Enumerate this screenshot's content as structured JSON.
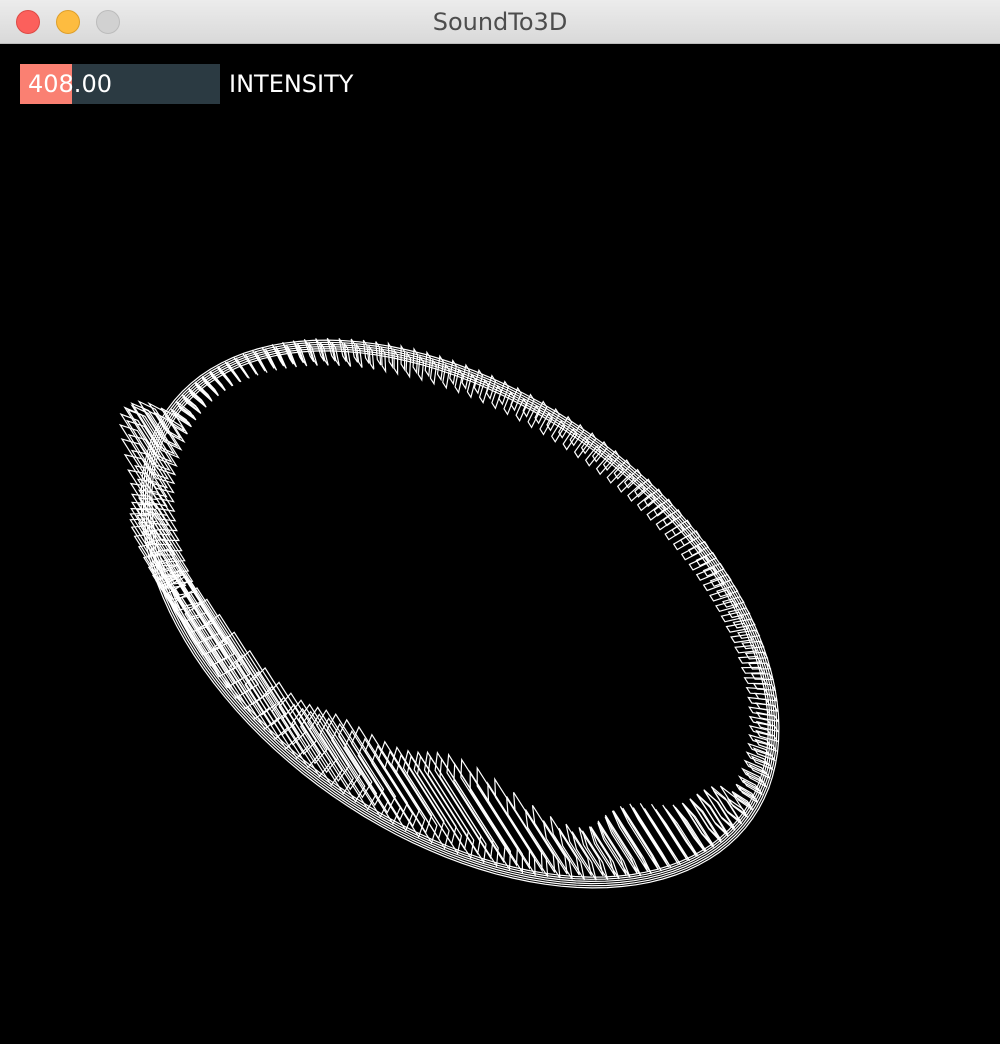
{
  "window": {
    "title": "SoundTo3D"
  },
  "controls": {
    "intensity": {
      "value_text": "408.00",
      "label": "INTENSITY",
      "fill_fraction": 0.26
    }
  },
  "colors": {
    "background": "#000000",
    "slider_track": "#2b3a42",
    "slider_fill": "#fa8072",
    "wireframe": "#ffffff"
  },
  "visualization": {
    "shape": "wireframe-ring-of-boxes",
    "stroke": "#ffffff"
  }
}
